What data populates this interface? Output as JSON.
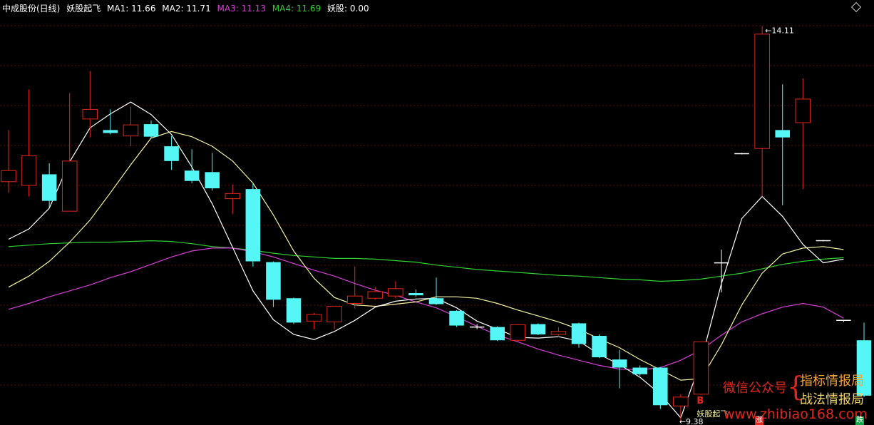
{
  "legend": {
    "stock": "中成股份(日线)",
    "indicator": "妖股起飞",
    "ma1": "MA1: 11.66",
    "ma2": "MA2: 11.71",
    "ma3": "MA3: 11.13",
    "ma4": "MA4: 11.69",
    "yao": "妖股: 0.00"
  },
  "colors": {
    "up": "#e0271d",
    "down": "#55f6f6",
    "ma1": "#ffffff",
    "ma2": "#f5f2a0",
    "ma3": "#d63fd6",
    "ma4": "#2fd12f",
    "legend_label": "#ffffff",
    "ma1_text": "#ffffff",
    "ma2_text": "#ffffff",
    "ma3_text": "#d63fd6",
    "ma4_text": "#2fd12f",
    "yao_text": "#ffffff"
  },
  "watermark": {
    "wechat": "微信公众号",
    "line1": "指标情报局",
    "line2": "战法情报局",
    "site": "www.zhibiao168.com",
    "brace": "{"
  },
  "markers": {
    "up_mark": "涨",
    "down_mark": "跌"
  },
  "chart_data": {
    "type": "candlestick",
    "ylim": [
      9.05,
      14.25
    ],
    "grid": true,
    "candles": [
      {
        "o": 12.0,
        "h": 12.7,
        "l": 11.85,
        "c": 12.15,
        "dir": "up"
      },
      {
        "o": 11.95,
        "h": 13.25,
        "l": 11.8,
        "c": 12.35,
        "dir": "up"
      },
      {
        "o": 12.1,
        "h": 12.25,
        "l": 11.65,
        "c": 11.74,
        "dir": "down"
      },
      {
        "o": 11.6,
        "h": 13.2,
        "l": 11.6,
        "c": 12.28,
        "dir": "up"
      },
      {
        "o": 12.85,
        "h": 13.5,
        "l": 12.6,
        "c": 12.98,
        "dir": "up"
      },
      {
        "o": 12.7,
        "h": 12.98,
        "l": 12.64,
        "c": 12.66,
        "dir": "down"
      },
      {
        "o": 12.62,
        "h": 13.02,
        "l": 12.48,
        "c": 12.77,
        "dir": "up"
      },
      {
        "o": 12.78,
        "h": 12.83,
        "l": 12.59,
        "c": 12.61,
        "dir": "down"
      },
      {
        "o": 12.48,
        "h": 12.62,
        "l": 12.16,
        "c": 12.28,
        "dir": "down"
      },
      {
        "o": 12.15,
        "h": 12.44,
        "l": 11.98,
        "c": 12.01,
        "dir": "down"
      },
      {
        "o": 12.13,
        "h": 12.39,
        "l": 11.88,
        "c": 11.91,
        "dir": "down"
      },
      {
        "o": 11.84,
        "h": 11.96,
        "l": 11.56,
        "c": 11.77,
        "dir": "up"
      },
      {
        "o": 11.9,
        "h": 11.97,
        "l": 10.85,
        "c": 10.92,
        "dir": "down"
      },
      {
        "o": 10.91,
        "h": 10.92,
        "l": 10.3,
        "c": 10.4,
        "dir": "down"
      },
      {
        "o": 10.42,
        "h": 10.43,
        "l": 10.07,
        "c": 10.09,
        "dir": "down"
      },
      {
        "o": 10.11,
        "h": 10.22,
        "l": 10.0,
        "c": 10.2,
        "dir": "up"
      },
      {
        "o": 10.1,
        "h": 10.3,
        "l": 10.0,
        "c": 10.31,
        "dir": "up"
      },
      {
        "o": 10.35,
        "h": 10.85,
        "l": 10.28,
        "c": 10.45,
        "dir": "up"
      },
      {
        "o": 10.42,
        "h": 10.57,
        "l": 10.4,
        "c": 10.51,
        "dir": "up"
      },
      {
        "o": 10.45,
        "h": 10.65,
        "l": 10.42,
        "c": 10.55,
        "dir": "up"
      },
      {
        "o": 10.49,
        "h": 10.54,
        "l": 10.44,
        "c": 10.46,
        "dir": "down"
      },
      {
        "o": 10.42,
        "h": 10.7,
        "l": 10.33,
        "c": 10.34,
        "dir": "down"
      },
      {
        "o": 10.25,
        "h": 10.26,
        "l": 10.03,
        "c": 10.05,
        "dir": "down"
      },
      {
        "o": 10.04,
        "h": 10.07,
        "l": 10.0,
        "c": 10.03,
        "dir": "doji"
      },
      {
        "o": 10.03,
        "h": 10.04,
        "l": 9.84,
        "c": 9.85,
        "dir": "down"
      },
      {
        "o": 9.85,
        "h": 10.07,
        "l": 9.84,
        "c": 10.06,
        "dir": "up"
      },
      {
        "o": 10.07,
        "h": 10.08,
        "l": 9.92,
        "c": 9.93,
        "dir": "down"
      },
      {
        "o": 9.93,
        "h": 10.03,
        "l": 9.89,
        "c": 9.97,
        "dir": "up"
      },
      {
        "o": 10.08,
        "h": 10.09,
        "l": 9.75,
        "c": 9.8,
        "dir": "down"
      },
      {
        "o": 9.91,
        "h": 9.93,
        "l": 9.61,
        "c": 9.62,
        "dir": "down"
      },
      {
        "o": 9.59,
        "h": 9.72,
        "l": 9.2,
        "c": 9.48,
        "dir": "down"
      },
      {
        "o": 9.48,
        "h": 9.51,
        "l": 9.37,
        "c": 9.39,
        "dir": "down"
      },
      {
        "o": 9.48,
        "h": 9.49,
        "l": 8.92,
        "c": 8.97,
        "dir": "down"
      },
      {
        "o": 8.96,
        "h": 9.12,
        "l": 8.75,
        "c": 9.08,
        "dir": "up"
      },
      {
        "o": 9.12,
        "h": 9.83,
        "l": 9.11,
        "c": 9.83,
        "dir": "up"
      },
      {
        "o": 10.9,
        "h": 11.08,
        "l": 10.5,
        "c": 10.9,
        "dir": "doji"
      },
      {
        "o": 12.38,
        "h": 12.39,
        "l": 12.37,
        "c": 12.38,
        "dir": "doji"
      },
      {
        "o": 12.45,
        "h": 14.11,
        "l": 11.8,
        "c": 14.0,
        "dir": "up"
      },
      {
        "o": 12.6,
        "h": 13.32,
        "l": 11.68,
        "c": 12.7,
        "dir": "down"
      },
      {
        "o": 12.8,
        "h": 13.4,
        "l": 11.9,
        "c": 13.12,
        "dir": "up"
      },
      {
        "o": 11.2,
        "h": 11.21,
        "l": 11.19,
        "c": 11.2,
        "dir": "doji"
      },
      {
        "o": 10.12,
        "h": 10.12,
        "l": 10.1,
        "c": 10.12,
        "dir": "doji"
      },
      {
        "o": 9.85,
        "h": 10.09,
        "l": 9.08,
        "c": 9.1,
        "dir": "down"
      }
    ],
    "ma1": [
      11.22,
      11.36,
      11.64,
      12.27,
      12.73,
      12.92,
      13.08,
      12.91,
      12.64,
      12.2,
      11.7,
      11.11,
      10.52,
      10.13,
      9.93,
      9.86,
      9.97,
      10.12,
      10.3,
      10.38,
      10.41,
      10.42,
      10.29,
      10.11,
      10.0,
      9.89,
      9.88,
      9.9,
      9.84,
      9.66,
      9.52,
      9.35,
      9.12,
      8.8,
      9.57,
      10.62,
      11.5,
      11.8,
      11.53,
      11.15,
      10.9,
      10.95
    ],
    "ma2": [
      10.57,
      10.72,
      10.92,
      11.18,
      11.48,
      11.85,
      12.23,
      12.59,
      12.68,
      12.61,
      12.48,
      12.28,
      11.98,
      11.55,
      11.06,
      10.69,
      10.43,
      10.33,
      10.31,
      10.34,
      10.37,
      10.44,
      10.44,
      10.42,
      10.35,
      10.26,
      10.18,
      10.1,
      10.0,
      9.87,
      9.75,
      9.59,
      9.45,
      9.31,
      9.33,
      9.79,
      10.33,
      10.76,
      11.02,
      11.1,
      11.12,
      11.08
    ],
    "ma3": [
      10.27,
      10.35,
      10.44,
      10.52,
      10.6,
      10.7,
      10.78,
      10.88,
      10.98,
      11.06,
      11.1,
      11.1,
      11.05,
      10.98,
      10.89,
      10.8,
      10.72,
      10.62,
      10.53,
      10.46,
      10.37,
      10.29,
      10.17,
      10.04,
      9.92,
      9.83,
      9.73,
      9.65,
      9.58,
      9.51,
      9.46,
      9.45,
      9.48,
      9.58,
      9.72,
      9.92,
      10.1,
      10.21,
      10.3,
      10.35,
      10.3,
      10.15
    ],
    "ma4": [
      11.12,
      11.14,
      11.16,
      11.17,
      11.18,
      11.18,
      11.19,
      11.2,
      11.19,
      11.16,
      11.12,
      11.1,
      11.07,
      11.03,
      11.0,
      10.98,
      10.96,
      10.96,
      10.95,
      10.93,
      10.91,
      10.87,
      10.84,
      10.81,
      10.79,
      10.77,
      10.75,
      10.73,
      10.72,
      10.7,
      10.68,
      10.67,
      10.65,
      10.66,
      10.68,
      10.72,
      10.76,
      10.82,
      10.88,
      10.92,
      10.95,
      10.97
    ],
    "high_label": "14.11",
    "low_label": "9.38",
    "signal": "B",
    "signal_text": "妖股起飞"
  }
}
